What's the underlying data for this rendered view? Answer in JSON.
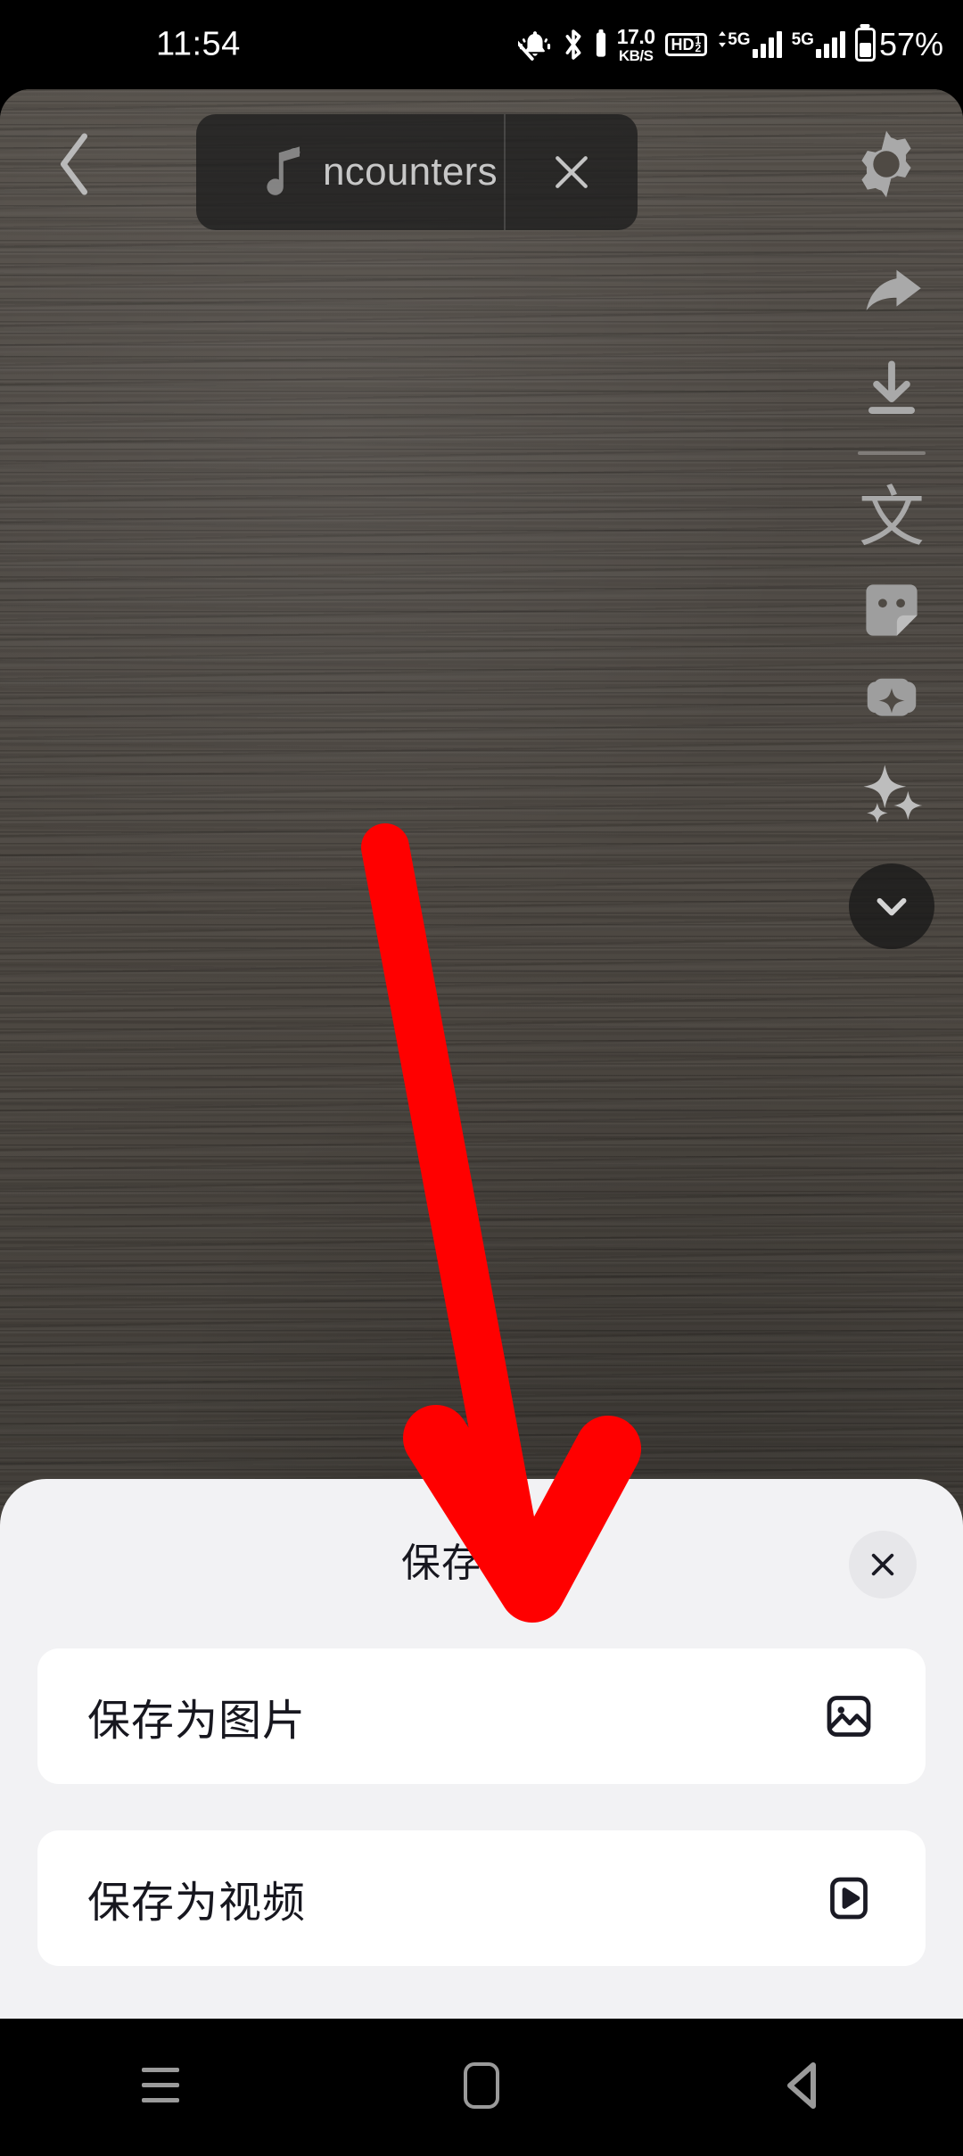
{
  "status_bar": {
    "time": "11:54",
    "mute_icon": "bell-muted-icon",
    "bluetooth_icon": "bluetooth-icon",
    "net_speed_value": "17.0",
    "net_speed_unit": "KB/S",
    "hd_label": "HD",
    "hd_sup": "1",
    "hd_sub": "2",
    "sim1_network": "5G",
    "sim2_network": "5G",
    "battery_percent": "57%",
    "battery_level": 57
  },
  "top_bar": {
    "back_icon": "chevron-left-icon",
    "music": {
      "note_icon": "music-note-icon",
      "title": "ncounters",
      "close_label": "✕"
    },
    "settings_icon": "gear-icon"
  },
  "right_rail": {
    "items": [
      {
        "name": "share-icon"
      },
      {
        "name": "download-icon"
      },
      {
        "name": "translate-icon",
        "glyph": "文"
      },
      {
        "name": "sticker-icon"
      },
      {
        "name": "add-badge-icon"
      },
      {
        "name": "sparkle-ai-icon"
      }
    ],
    "collapse_icon": "chevron-down-icon"
  },
  "sheet": {
    "title": "保存本地",
    "close_label": "✕",
    "options": [
      {
        "label": "保存为图片",
        "icon": "image-icon"
      },
      {
        "label": "保存为视频",
        "icon": "play-icon"
      }
    ]
  },
  "annotation": {
    "arrow_color": "#ff0000",
    "arrow_points_to": "保存为图片"
  },
  "nav_bar": {
    "recents_icon": "recents-icon",
    "home_icon": "home-icon",
    "back_icon": "back-triangle-icon"
  },
  "colors": {
    "sheet_bg": "#f2f2f4",
    "card_bg": "#ffffff",
    "text": "#17171f",
    "accent_red": "#ff0000",
    "photo_bg": "#4a453f"
  }
}
